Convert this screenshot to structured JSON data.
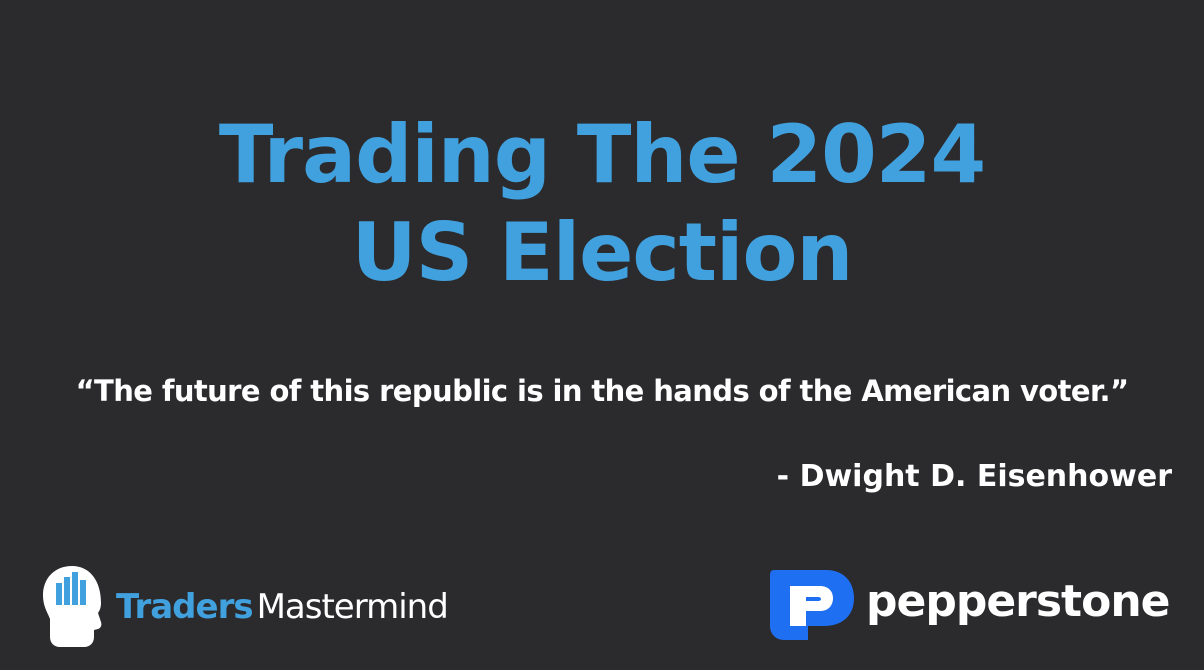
{
  "title": {
    "line1": "Trading The 2024",
    "line2": "US Election"
  },
  "quote": {
    "text": "“The future of this republic is in the hands of the American voter.”",
    "attribution": "- Dwight D. Eisenhower"
  },
  "logos": {
    "traders_mastermind": {
      "word1": "Traders",
      "word2": "Mastermind",
      "icon": "head-with-bar-chart-icon"
    },
    "pepperstone": {
      "wordmark": "pepperstone",
      "icon": "pepperstone-p-mark-icon"
    }
  },
  "colors": {
    "background": "#2b2a2d",
    "accent_blue": "#41a1de",
    "pepperstone_blue": "#1f6ff2",
    "text_white": "#ffffff"
  }
}
